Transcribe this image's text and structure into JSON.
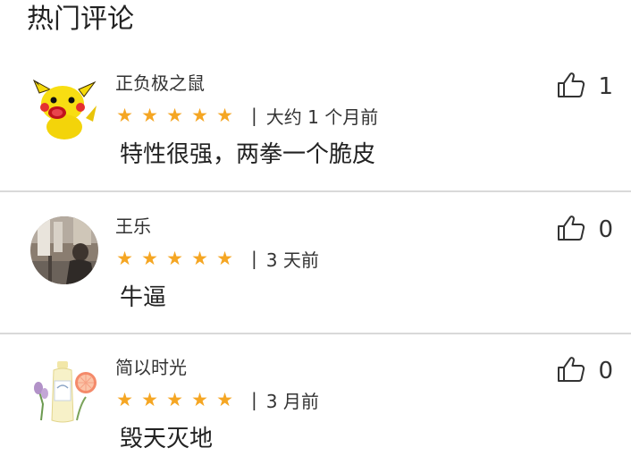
{
  "section_title": "热门评论",
  "comments": [
    {
      "username": "正负极之鼠",
      "rating": 5,
      "time": "大约 1 个月前",
      "content": "特性很强，两拳一个脆皮",
      "likes": "1"
    },
    {
      "username": "王乐",
      "rating": 5,
      "time": "3 天前",
      "content": "牛逼",
      "likes": "0"
    },
    {
      "username": "简以时光",
      "rating": 5,
      "time": "3 月前",
      "content": "毁天灭地",
      "likes": "0"
    }
  ],
  "star_glyph": "★",
  "separator": "|",
  "colors": {
    "star": "#f5a623",
    "divider": "#d9d9d9",
    "text": "#222222"
  },
  "icons": {
    "like": "thumbs-up-icon",
    "star": "star-icon"
  }
}
